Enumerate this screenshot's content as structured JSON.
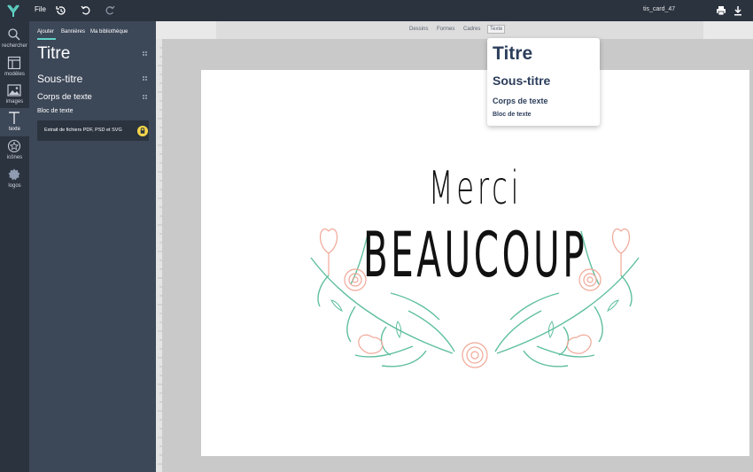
{
  "topbar": {
    "file_label": "File",
    "doc_name": "tis_card_47",
    "icons": [
      "logo-icon",
      "history-icon",
      "undo-icon",
      "redo-icon",
      "print-icon",
      "download-icon"
    ]
  },
  "rail": {
    "items": [
      {
        "label": "rechercher",
        "icon": "search-icon"
      },
      {
        "label": "modèles",
        "icon": "templates-icon"
      },
      {
        "label": "images",
        "icon": "image-icon"
      },
      {
        "label": "texte",
        "icon": "text-icon"
      },
      {
        "label": "icônes",
        "icon": "star-icon"
      },
      {
        "label": "logos",
        "icon": "logo-shape-icon"
      }
    ]
  },
  "panel": {
    "tabs": [
      "Ajouter",
      "Bannières",
      "Ma bibliothèque"
    ],
    "items": [
      "Titre",
      "Sous-titre",
      "Corps de texte",
      "Bloc de texte"
    ],
    "pdf_extract": "Extrait de fichiers PDF, PSD et SVG"
  },
  "subtabs": [
    "Dessins",
    "Formes",
    "Cadres",
    "Texte"
  ],
  "canvas": {
    "line1": "Merci",
    "line2": "BEAUCOUP"
  },
  "dropdown": {
    "items": [
      "Titre",
      "Sous-titre",
      "Corps de texte",
      "Bloc de texte"
    ]
  },
  "colors": {
    "topbar": "#2b333f",
    "panel": "#3c4758",
    "accent": "#5fd4c7",
    "lock": "#f5d44b",
    "leaf": "#5fbf9f",
    "flower": "#f0a898"
  }
}
